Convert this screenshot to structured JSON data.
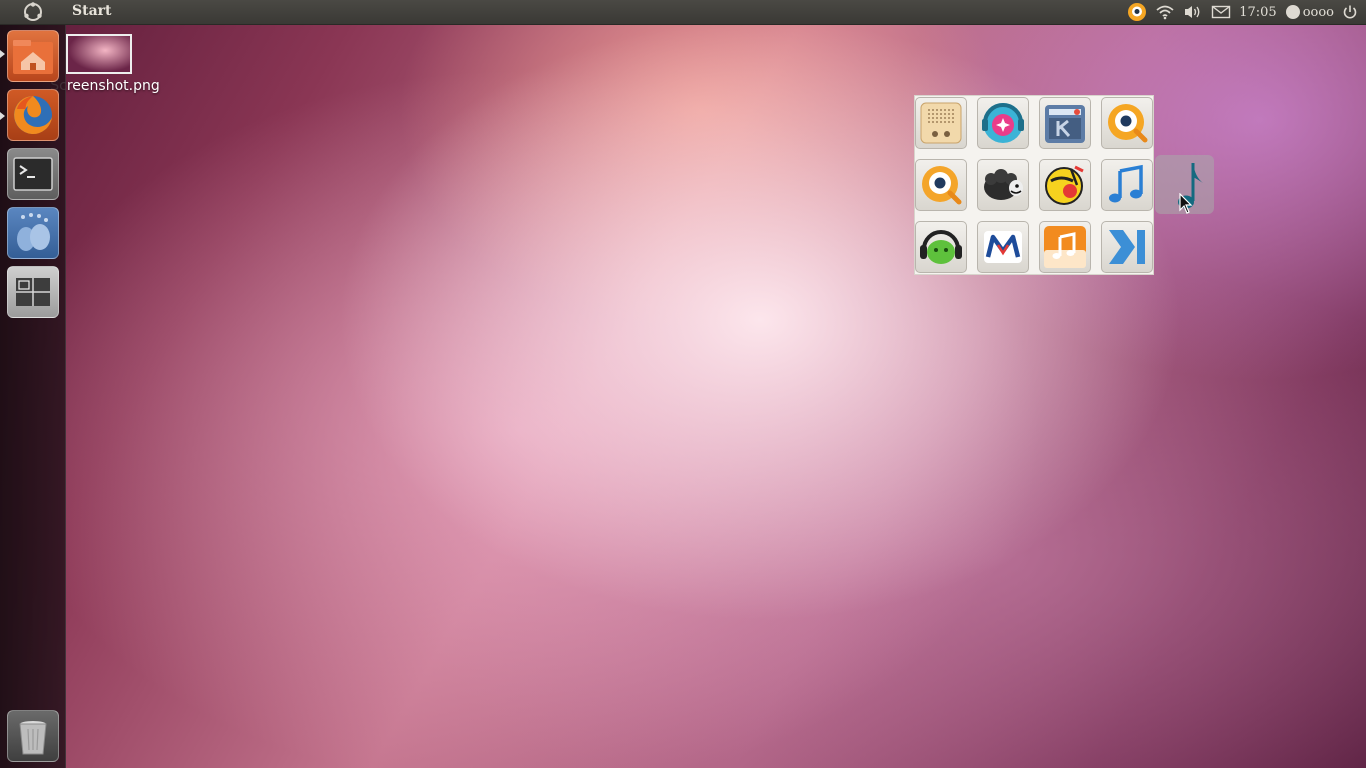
{
  "top_panel": {
    "window_title": "Start",
    "clock": "17:05",
    "user_name": "oooo",
    "icons": [
      "ubuntu-logo-icon",
      "qq-tray-icon",
      "wifi-icon",
      "volume-icon",
      "mail-icon",
      "user-icon",
      "power-icon"
    ]
  },
  "launcher": {
    "items": [
      {
        "name": "home-folder",
        "icon": "home-folder-icon"
      },
      {
        "name": "firefox",
        "icon": "firefox-icon"
      },
      {
        "name": "terminal",
        "icon": "terminal-icon"
      },
      {
        "name": "gwibber",
        "icon": "gwibber-icon"
      },
      {
        "name": "workspace-switcher",
        "icon": "workspace-switcher-icon"
      },
      {
        "name": "trash",
        "icon": "trash-icon"
      }
    ]
  },
  "desktop": {
    "file_label": "Screenshot.png"
  },
  "icon_grid": {
    "rows": [
      [
        "radio-icon",
        "music-player-pink-icon",
        "k-radio-icon",
        "qq-player-icon"
      ],
      [
        "qq-player-alt-icon",
        "sheep-icon",
        "ttplayer-icon",
        "music-note-blue-icon"
      ],
      [
        "green-headphones-icon",
        "m-logo-icon",
        "orange-music-icon",
        "next-arrow-icon"
      ]
    ],
    "dragging_icon": "music-note-teal-icon"
  },
  "colors": {
    "panel": "#3c3b37",
    "accent_orange": "#e9541f"
  }
}
